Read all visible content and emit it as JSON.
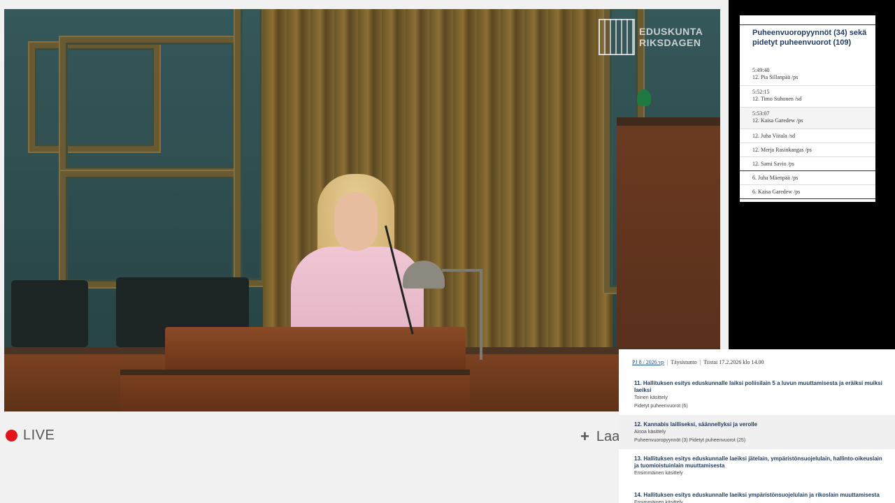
{
  "brand": {
    "line1": "EDUSKUNTA",
    "line2": "RIKSDAGEN"
  },
  "live": {
    "label": "LIVE",
    "color": "#e3131b"
  },
  "add": {
    "label": "Laa"
  },
  "speakers": {
    "title": "Puheenvuoropyynnöt (34) sekä pidetyt puheenvuorot (109)",
    "items": [
      {
        "time": "5:49:40",
        "name": "12. Pia Sillanpää /ps"
      },
      {
        "time": "5:52:15",
        "name": "12. Timo Suhonen /sd"
      },
      {
        "time": "5:53:07",
        "name": "12. Kaisa Garedew /ps"
      },
      {
        "time": "",
        "name": "12. Juha Viitala /sd"
      },
      {
        "time": "",
        "name": "12. Merja Rasinkangas /ps"
      },
      {
        "time": "",
        "name": "12. Sami Savio /ps"
      },
      {
        "time": "",
        "name": "6. Juha Mäenpää /ps"
      },
      {
        "time": "",
        "name": "6. Kaisa Garedew /ps"
      }
    ]
  },
  "agenda": {
    "doc": "PJ 8 / 2026 vp",
    "session": "Täysistunto",
    "date": "Tiistai 17.2.2026 klo 14.00",
    "sep": "|",
    "items": [
      {
        "title": "11. Hallituksen esitys eduskunnalle laiksi poliisilain 5 a luvun muuttamisesta ja eräiksi muiksi laeiksi",
        "sub1": "Toinen käsittely",
        "sub2": "Pidetyt puheenvuorot (6)"
      },
      {
        "title": "12. Kannabis lailliseksi, säännellyksi ja verolle",
        "sub1": "Ainoa käsittely",
        "sub2": "Puheenvuoropyynnöt (3) Pidetyt puheenvuorot (25)"
      },
      {
        "title": "13. Hallituksen esitys eduskunnalle laeiksi jätelain, ympäristönsuojelulain, hallinto-oikeuslain ja tuomioistuinlain muuttamisesta",
        "sub1": "Ensimmäinen käsittely",
        "sub2": ""
      },
      {
        "title": "14. Hallituksen esitys eduskunnalle laeiksi ympäristönsuojelulain ja rikoslain muuttamisesta",
        "sub1": "Ensimmäinen käsittely",
        "sub2": ""
      }
    ]
  }
}
